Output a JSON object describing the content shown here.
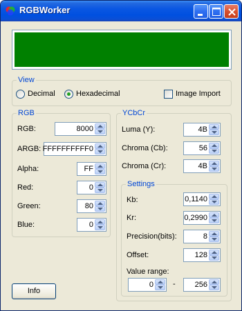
{
  "window": {
    "title": "RGBWorker"
  },
  "colors": {
    "preview": "#008000",
    "titlebar": "#0a57e2",
    "group_label": "#0046d5"
  },
  "view": {
    "label": "View",
    "decimal_label": "Decimal",
    "hex_label": "Hexadecimal",
    "image_import_label": "Image Import",
    "selected": "Hexadecimal",
    "image_import_checked": false
  },
  "rgb": {
    "label": "RGB",
    "rgb_label": "RGB:",
    "rgb_value": "8000",
    "argb_label": "ARGB:",
    "argb_value": "FFFFFFFFFF0",
    "alpha_label": "Alpha:",
    "alpha_value": "FF",
    "red_label": "Red:",
    "red_value": "0",
    "green_label": "Green:",
    "green_value": "80",
    "blue_label": "Blue:",
    "blue_value": "0"
  },
  "ycbcr": {
    "label": "YCbCr",
    "luma_label": "Luma (Y):",
    "luma_value": "4B",
    "cb_label": "Chroma (Cb):",
    "cb_value": "56",
    "cr_label": "Chroma (Cr):",
    "cr_value": "4B"
  },
  "settings": {
    "label": "Settings",
    "kb_label": "Kb:",
    "kb_value": "0,1140",
    "kr_label": "Kr:",
    "kr_value": "0,2990",
    "precision_label": "Precision(bits):",
    "precision_value": "8",
    "offset_label": "Offset:",
    "offset_value": "128",
    "range_label": "Value range:",
    "range_min": "0",
    "range_sep": "-",
    "range_max": "256"
  },
  "buttons": {
    "info_label": "Info"
  }
}
